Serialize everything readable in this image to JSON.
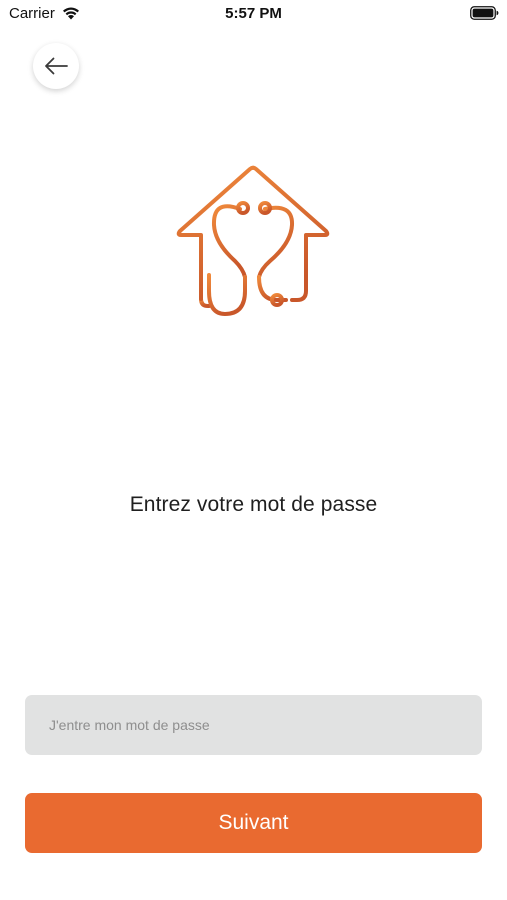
{
  "status_bar": {
    "carrier": "Carrier",
    "time": "5:57 PM",
    "wifi_icon": "wifi-icon",
    "battery_icon": "battery-icon"
  },
  "header": {
    "back_icon": "arrow-left-icon"
  },
  "logo": {
    "icon": "house-stethoscope-logo",
    "gradient_start": "#f08a3c",
    "gradient_end": "#c9572a"
  },
  "main": {
    "prompt": "Entrez votre mot de passe"
  },
  "form": {
    "password_placeholder": "J'entre mon mot de passe",
    "password_value": "",
    "submit_label": "Suivant"
  },
  "colors": {
    "accent": "#e96a30",
    "input_background": "#e1e2e2",
    "background": "#ffffff"
  }
}
